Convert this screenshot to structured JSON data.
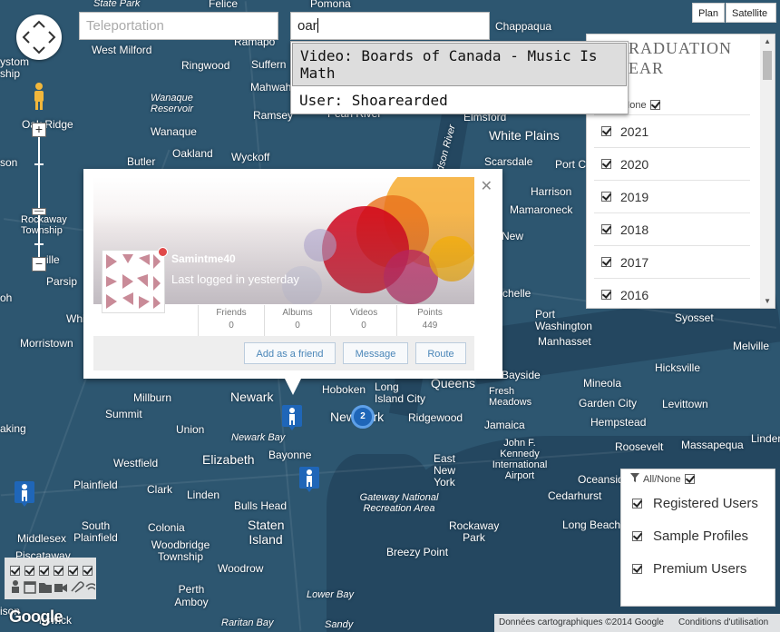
{
  "search": {
    "teleport_placeholder": "Teleportation",
    "user_query": "oar",
    "suggestions": [
      "Video: Boards of Canada - Music Is Math",
      "User: Shoarearded"
    ]
  },
  "map_type": {
    "plan": "Plan",
    "satellite": "Satellite"
  },
  "graduation": {
    "title": "GRADUATION YEAR",
    "all_none": "All/None",
    "years": [
      "2021",
      "2020",
      "2019",
      "2018",
      "2017",
      "2016"
    ]
  },
  "user_types": {
    "all_none": "All/None",
    "items": [
      "Registered Users",
      "Sample Profiles",
      "Premium Users"
    ]
  },
  "popup": {
    "username": "Samintme40",
    "last_login": "Last logged in yesterday",
    "stats": [
      {
        "label": "Friends",
        "value": "0"
      },
      {
        "label": "Albums",
        "value": "0"
      },
      {
        "label": "Videos",
        "value": "0"
      },
      {
        "label": "Points",
        "value": "449"
      }
    ],
    "buttons": {
      "add_friend": "Add as a friend",
      "message": "Message",
      "route": "Route"
    }
  },
  "cluster_count": "2",
  "map_labels": {
    "state_park": "State Park",
    "felice": "Felice",
    "pomona": "Pomona",
    "chappaqua": "Chappaqua",
    "ystom": "ystom",
    "ship": "ship",
    "west_milford": "West Milford",
    "ramapo": "Ramapo",
    "ringwood": "Ringwood",
    "suffern": "Suffern",
    "mahwah": "Mahwah",
    "wanaque_reservoir": "Wanaque Reservoir",
    "ramsey": "Ramsey",
    "pearl_river": "Pearl River",
    "elmsford": "Elmsford",
    "hudson_river": "udson River",
    "white_plains": "White Plains",
    "oak_ridge": "Oak Ridge",
    "wanaque": "Wanaque",
    "oakland": "Oakland",
    "wyckoff": "Wyckoff",
    "butler": "Butler",
    "son": "son",
    "scarsdale": "Scarsdale",
    "port_c": "Port C",
    "harrison": "Harrison",
    "mamaroneck": "Mamaroneck",
    "rockaway_township": "Rockaway Township",
    "new": "New",
    "ville": "ville",
    "parsippany": "Parsip",
    "wh": "Whi",
    "oh": "oh",
    "chelle": "chelle",
    "port_washington": "Port Washington",
    "manhasset": "Manhasset",
    "syosset": "Syosset",
    "morristown": "Morristown",
    "melville": "Melville",
    "hicksville": "Hicksville",
    "newark": "Newark",
    "hoboken": "Hoboken",
    "long_island_city": "Long Island City",
    "queens": "Queens",
    "bayside": "Bayside",
    "mineola": "Mineola",
    "millburn": "Millburn",
    "fresh_meadows": "Fresh Meadows",
    "garden_city": "Garden City",
    "levittown": "Levittown",
    "new_york": "New York",
    "ridgewood": "Ridgewood",
    "hempstead": "Hempstead",
    "summit": "Summit",
    "aking": "aking",
    "union": "Union",
    "jamaica": "Jamaica",
    "jfk": "John F. Kennedy International Airport",
    "roosevelt": "Roosevelt",
    "massapequa": "Massapequa",
    "linden_east": "Linder",
    "newark_bay": "Newark Bay",
    "elizabeth": "Elizabeth",
    "bayonne": "Bayonne",
    "westfield": "Westfield",
    "east_new_york": "East New York",
    "oceanside": "Oceanside",
    "plainfield": "Plainfield",
    "clark": "Clark",
    "linden": "Linden",
    "gateway": "Gateway National Recreation Area",
    "cedarhurst": "Cedarhurst",
    "bulls_head": "Bulls Head",
    "staten_island": "Staten Island",
    "rockaway_park": "Rockaway Park",
    "long_beach": "Long Beach",
    "middlesex": "Middlesex",
    "south_plainfield": "South Plainfield",
    "colonia": "Colonia",
    "woodbridge": "Woodbridge Township",
    "breezy_point": "Breezy Point",
    "piscataway": "Piscataway",
    "woodrow": "Woodrow",
    "perth_amboy": "Perth Amboy",
    "lower_bay": "Lower Bay",
    "ison": "ison",
    "nswick": "nswick",
    "raritan_bay": "Raritan Bay",
    "sandy": "Sandy"
  },
  "attribution": {
    "data": "Données cartographiques ©2014 Google",
    "terms": "Conditions d'utilisation"
  },
  "google": "Google",
  "colors": {
    "map_bg": "#2d5670",
    "accent_blue": "#1f66b8",
    "link_blue": "#4a86b8",
    "online_dot": "#e04848"
  }
}
